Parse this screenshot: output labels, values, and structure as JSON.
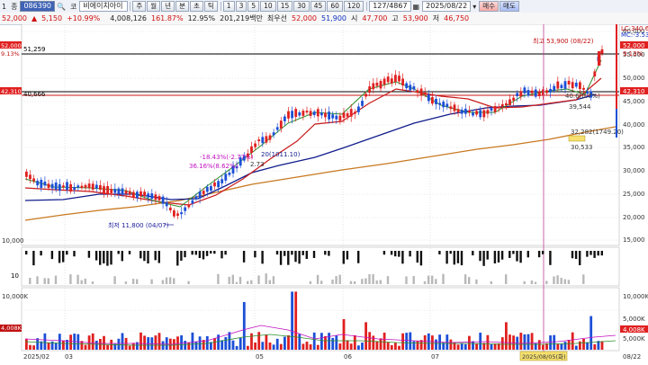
{
  "toolbar1": {
    "items": [
      "1",
      "종",
      "086390"
    ],
    "icon": "search-icon",
    "market_tag": "코",
    "stock_name": "비에이치아이",
    "period_buttons": [
      "주",
      "월",
      "년",
      "분",
      "초",
      "틱"
    ],
    "minute_buttons": [
      "1",
      "3",
      "5",
      "10",
      "15",
      "30",
      "45",
      "60",
      "120"
    ],
    "count_value": "127",
    "count_total": "4867",
    "date_value": "2025/08/22",
    "buy_label": "매수",
    "sell_label": "매도"
  },
  "toolbar2": {
    "price": "52,000",
    "change_mark": "▲",
    "change": "5,150",
    "change_pct": "+10.99%",
    "volume": "4,008,126",
    "vol_ratio": "161.87%",
    "turnover": "12.95%",
    "amount": "201,219백만",
    "best_label": "최우선",
    "best_price": "52,000",
    "ask_price": "51,900",
    "open_label": "시",
    "open": "47,700",
    "high_label": "고",
    "high": "53,900",
    "low_label": "저",
    "low": "46,750"
  },
  "price_axis": {
    "ticks": [
      "60,000",
      "55,000",
      "50,000",
      "45,000",
      "40,000",
      "35,000",
      "30,000",
      "25,000",
      "20,000",
      "15,000",
      "10,000"
    ],
    "badge_current": "52,000",
    "badge_pct": "9.13%",
    "badge_low": "42,310",
    "lc_label": "LC:340.68",
    "mc_label": "MC:-3.53",
    "left_badge_price": "52,000",
    "left_badge_pct": "9.13%",
    "left_badge_low": "42,310"
  },
  "levels": {
    "upper": "51,259",
    "lower": "40,666"
  },
  "annotations": {
    "high_note": "최고 53,900 (08/22)",
    "low_note": "최저 11,800 (04/07)",
    "ma_note1": "-18.43%(-2.77%)",
    "ma_note2": "36.16%(8.62%)",
    "ma_note3": "20(1011.10)",
    "ma_note4": "2.73",
    "ma_note5": "40.6(0.7%)",
    "ma_note6": "39,544",
    "ma_note7": "32,282(1749.20)",
    "ma_note8": "30,533"
  },
  "osc_axis": {
    "tick": "10"
  },
  "volume_axis": {
    "ticks": [
      "10,000K",
      "5,000K"
    ],
    "current": "4,008K",
    "left_label": "4,008K",
    "right_marker": "5,000K"
  },
  "date_axis": {
    "labels": [
      "2025/02",
      "03",
      "05",
      "06",
      "07",
      "08/22"
    ],
    "cursor_date": "2025/08/05(화)"
  },
  "colors": {
    "up": "#e02020",
    "down": "#1c4fd6",
    "ma5": "#2a8f2a",
    "ma20": "#c81a1a",
    "ma60": "#101c8c",
    "ma120": "#c87820",
    "grid": "#d4d4d4"
  }
}
